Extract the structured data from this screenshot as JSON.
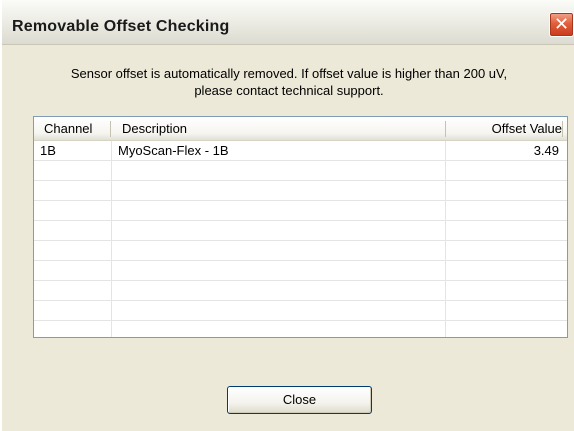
{
  "window": {
    "title": "Removable Offset Checking",
    "close_glyph": "✕"
  },
  "message": {
    "line1": "Sensor offset is automatically removed. If offset value is higher than 200 uV,",
    "line2": "please contact technical support."
  },
  "table": {
    "columns": [
      "Channel",
      "Description",
      "Offset Value"
    ],
    "rows": [
      {
        "channel": "1B",
        "description": "MyoScan-Flex - 1B",
        "offset": "3.49"
      }
    ],
    "empty_row_count": 9
  },
  "buttons": {
    "close_label": "Close"
  },
  "colors": {
    "dialog_bg": "#ece9d8",
    "close_x_red": "#e0603e",
    "button_border": "#003c74"
  }
}
